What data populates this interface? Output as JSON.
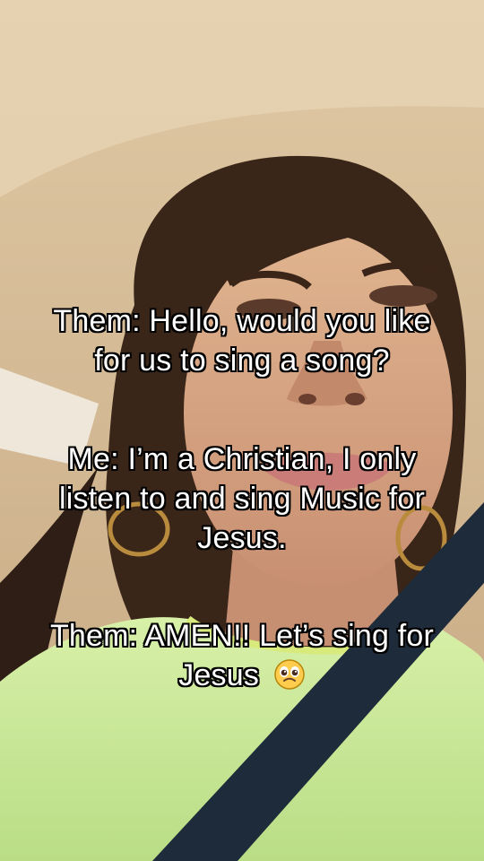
{
  "caption": {
    "line1_a": "Them: Hello, would you like",
    "line1_b": "for us to sing a song?",
    "line2_a": "Me: I’m a Christian, I only",
    "line2_b": "listen to and sing Music for",
    "line2_c": "Jesus.",
    "line3_a": "Them: AMEN!! Let’s sing for",
    "line3_b": "Jesus",
    "emoji_icon": "pleading-face-icon"
  },
  "colors": {
    "text": "#ffffff",
    "outline": "#000000",
    "shirt": "#c9e79a",
    "seatbelt": "#1d2b3a"
  }
}
